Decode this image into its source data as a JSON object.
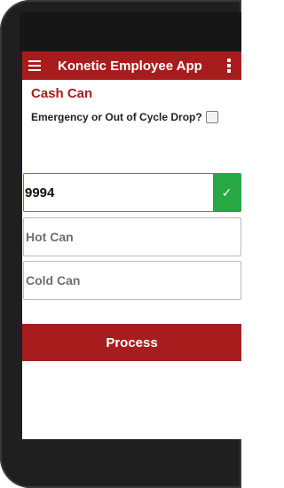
{
  "appbar": {
    "title": "Konetic Employee App",
    "menu_icon": "hamburger-menu-icon",
    "overflow_icon": "vertical-dots-icon"
  },
  "section": {
    "title": "Cash Can"
  },
  "emergency": {
    "label": "Emergency or Out of Cycle Drop?",
    "checked": false
  },
  "fields": {
    "code_value": "9994",
    "code_status_icon": "✓",
    "hot_placeholder": "Hot Can",
    "cold_placeholder": "Cold Can"
  },
  "actions": {
    "process_label": "Process"
  },
  "colors": {
    "brand": "#a71d1d",
    "success": "#28a745"
  }
}
